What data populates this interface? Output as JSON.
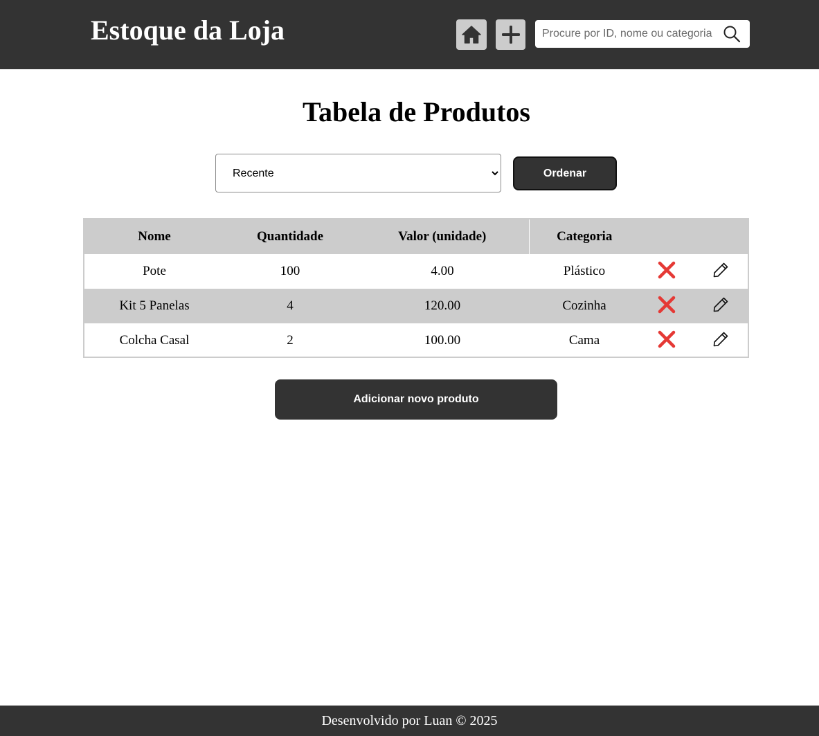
{
  "header": {
    "logo_text": "Estoque da Loja",
    "home_icon": "home-icon",
    "add_icon": "plus-icon",
    "search_placeholder": "Procure por ID, nome ou categoria",
    "search_value": "",
    "search_icon": "search-icon"
  },
  "main": {
    "title": "Tabela de Produtos",
    "sort": {
      "selected": "Recente",
      "options": [
        "Recente"
      ],
      "button_label": "Ordenar"
    },
    "table": {
      "columns": [
        "Nome",
        "Quantidade",
        "Valor (unidade)",
        "Categoria"
      ],
      "rows": [
        {
          "nome": "Pote",
          "quantidade": "100",
          "valor": "4.00",
          "categoria": "Plástico"
        },
        {
          "nome": "Kit 5 Panelas",
          "quantidade": "4",
          "valor": "120.00",
          "categoria": "Cozinha"
        },
        {
          "nome": "Colcha Casal",
          "quantidade": "2",
          "valor": "100.00",
          "categoria": "Cama"
        }
      ],
      "delete_icon": "cross-mark-icon",
      "edit_icon": "pencil-icon"
    },
    "add_button_label": "Adicionar novo produto"
  },
  "footer": {
    "text": "Desenvolvido por Luan © 2025"
  },
  "colors": {
    "header_bg": "#333333",
    "row_alt_bg": "#cccccc",
    "icon_btn_bg": "#cccccc",
    "delete_red": "#e53935"
  }
}
